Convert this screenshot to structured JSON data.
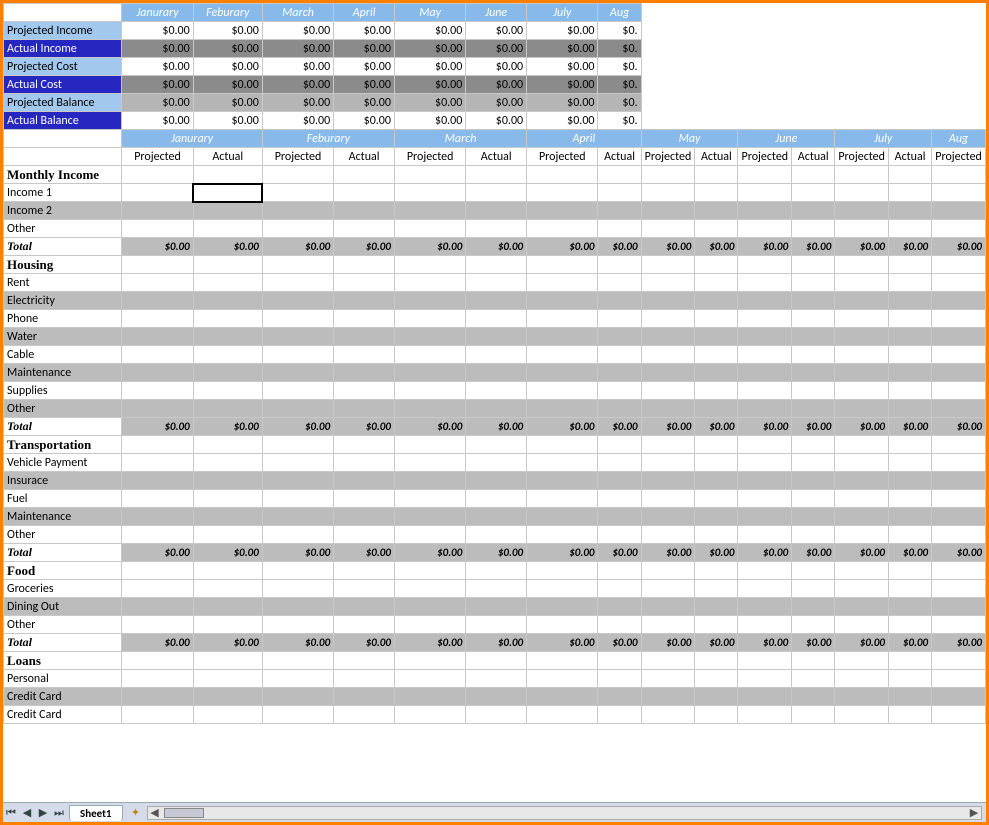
{
  "months": [
    "Janurary",
    "Feburary",
    "March",
    "April",
    "May",
    "June",
    "July",
    "Aug"
  ],
  "zero": "$0.00",
  "zeroClip": "$0.",
  "summaryRows": [
    {
      "label": "Projected Income",
      "labelClass": "summary-label-light",
      "rowClass": "row-white"
    },
    {
      "label": "Actual Income",
      "labelClass": "summary-label-dark",
      "rowClass": "row-gray"
    },
    {
      "label": "Projected Cost",
      "labelClass": "summary-label-light",
      "rowClass": "row-white"
    },
    {
      "label": "Actual Cost",
      "labelClass": "summary-label-dark",
      "rowClass": "row-gray"
    },
    {
      "label": "Projected Balance",
      "labelClass": "summary-label-light",
      "rowClass": "row-midgray"
    },
    {
      "label": "Actual Balance",
      "labelClass": "summary-label-dark",
      "rowClass": "row-white"
    }
  ],
  "subcols": [
    "Projected",
    "Actual"
  ],
  "sections": [
    {
      "name": "Monthly Income",
      "items": [
        "Income 1",
        "Income 2",
        "Other"
      ]
    },
    {
      "name": "Housing",
      "items": [
        "Rent",
        "Electricity",
        "Phone",
        "Water",
        "Cable",
        "Maintenance",
        "Supplies",
        "Other"
      ]
    },
    {
      "name": "Transportation",
      "items": [
        "Vehicle Payment",
        "Insurace",
        "Fuel",
        "Maintenance",
        "Other"
      ]
    },
    {
      "name": "Food",
      "items": [
        "Groceries",
        "Dining Out",
        "Other"
      ]
    },
    {
      "name": "Loans",
      "items": [
        "Personal",
        "Credit Card",
        "Credit Card"
      ],
      "noTotal": true
    }
  ],
  "totalLabel": "Total",
  "sheetTab": "Sheet1",
  "selectedCell": {
    "section": 0,
    "item": 0,
    "col": 1
  }
}
